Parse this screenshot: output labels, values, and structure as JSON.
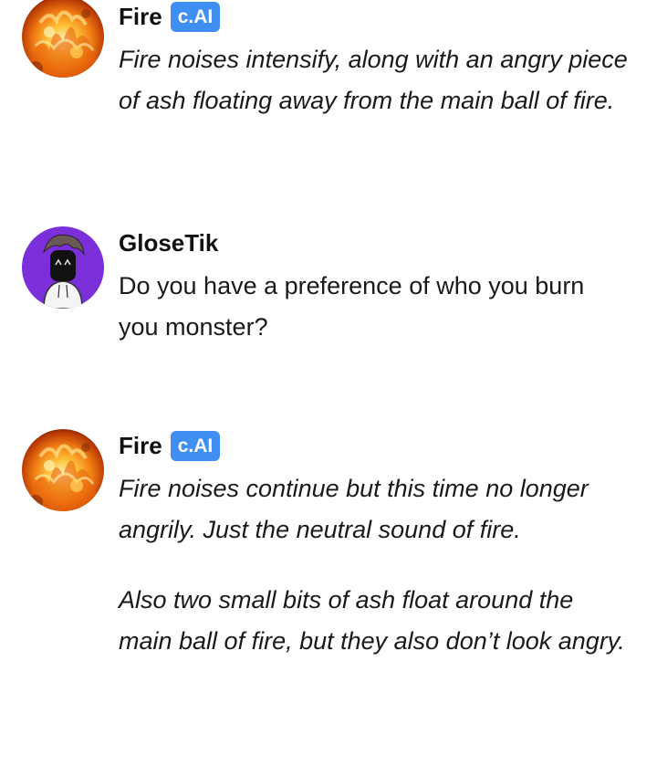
{
  "messages": [
    {
      "author": "Fire",
      "badge": "c.AI",
      "avatar_icon": "fire-icon",
      "italic": true,
      "paragraphs": [
        "Fire noises intensify, along with an angry piece of ash floating away from the main ball of fire."
      ]
    },
    {
      "author": "GloseTik",
      "avatar_icon": "user-avatar-icon",
      "italic": false,
      "paragraphs": [
        "Do you have a preference of who you burn you monster?"
      ]
    },
    {
      "author": "Fire",
      "badge": "c.AI",
      "avatar_icon": "fire-icon",
      "italic": true,
      "paragraphs": [
        "Fire noises continue but this time no longer angrily. Just the neutral sound of fire.",
        "Also two small bits of ash float around the main ball of fire, but they also don’t look angry."
      ]
    }
  ],
  "colors": {
    "badge_bg": "#3f8ef2",
    "text": "#1a1a1a",
    "avatar_purple": "#7a2fd8"
  }
}
